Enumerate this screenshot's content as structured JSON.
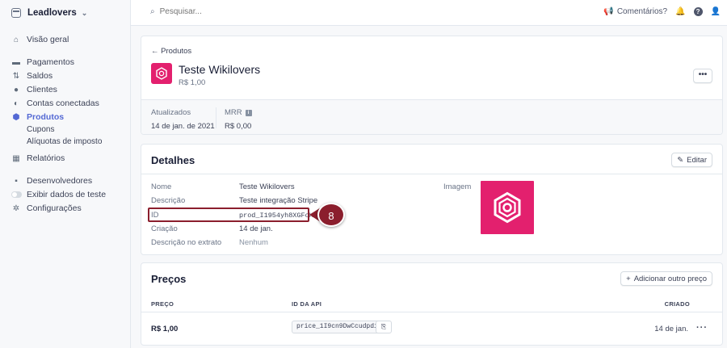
{
  "sidebar": {
    "account": "Leadlovers",
    "items": [
      {
        "label": "Visão geral",
        "icon": "home-icon"
      },
      {
        "label": "Pagamentos",
        "icon": "payments-icon"
      },
      {
        "label": "Saldos",
        "icon": "balances-icon"
      },
      {
        "label": "Clientes",
        "icon": "customers-icon"
      },
      {
        "label": "Contas conectadas",
        "icon": "connected-icon"
      },
      {
        "label": "Produtos",
        "icon": "products-icon",
        "active": true
      },
      {
        "label": "Relatórios",
        "icon": "reports-icon"
      },
      {
        "label": "Desenvolvedores",
        "icon": "developers-icon"
      },
      {
        "label": "Exibir dados de teste",
        "icon": "toggle-icon"
      },
      {
        "label": "Configurações",
        "icon": "gear-icon"
      }
    ],
    "subitems": [
      "Cupons",
      "Alíquotas de imposto"
    ]
  },
  "topbar": {
    "search_placeholder": "Pesquisar...",
    "feedback": "Comentários?"
  },
  "product": {
    "back_link": "← Produtos",
    "name": "Teste Wikilovers",
    "price": "R$ 1,00",
    "more": "•••",
    "stats": [
      {
        "label": "Atualizados",
        "value": "14 de jan. de 2021"
      },
      {
        "label": "MRR",
        "value": "R$ 0,00"
      }
    ]
  },
  "details": {
    "title": "Detalhes",
    "edit_label": "Editar",
    "fields": [
      {
        "label": "Nome",
        "value": "Teste Wikilovers"
      },
      {
        "label": "Descrição",
        "value": "Teste integração Stripe"
      },
      {
        "label": "ID",
        "value": "prod_I1954yh8XGFoKo"
      },
      {
        "label": "Criação",
        "value": "14 de jan."
      },
      {
        "label": "Descrição no extrato",
        "value": "Nenhum"
      }
    ],
    "image_label": "Imagem",
    "callout": "8",
    "callout_color": "#8b1e2d"
  },
  "prices": {
    "title": "Preços",
    "add_label": "Adicionar outro preço",
    "columns": [
      "PREÇO",
      "ID DA API",
      "CRIADO"
    ],
    "rows": [
      {
        "price": "R$ 1,00",
        "api_id": "price_1I9cn9DwCcudpdiP",
        "created": "14 de jan."
      }
    ]
  },
  "colors": {
    "accent": "#5469d4",
    "brand_pink": "#e3206e"
  }
}
